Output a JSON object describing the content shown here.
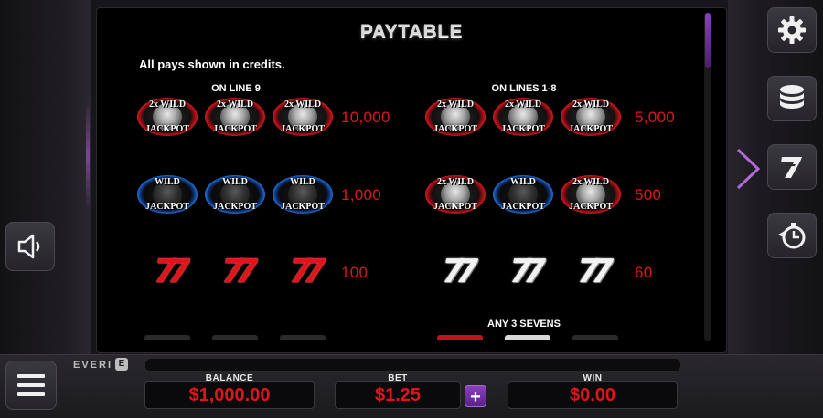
{
  "paytable": {
    "title": "PAYTABLE",
    "subtitle": "All pays shown in credits.",
    "col_left_heading": "ON LINE 9",
    "col_right_heading": "ON LINES 1-8",
    "any_sevens_heading": "ANY 3 SEVENS",
    "rows": [
      {
        "left": {
          "symbols": [
            "wild2x",
            "wild2x",
            "wild2x"
          ],
          "amount": "10,000"
        },
        "right": {
          "symbols": [
            "wild2x",
            "wild2x",
            "wild2x"
          ],
          "amount": "5,000"
        }
      },
      {
        "left": {
          "symbols": [
            "wild",
            "wild",
            "wild"
          ],
          "amount": "1,000"
        },
        "right": {
          "symbols": [
            "wild2x",
            "wild",
            "wild2x"
          ],
          "amount": "500"
        }
      },
      {
        "left": {
          "symbols": [
            "red7",
            "red7",
            "red7"
          ],
          "amount": "100"
        },
        "right": {
          "symbols": [
            "white7",
            "white7",
            "white7"
          ],
          "amount": "60"
        }
      }
    ],
    "badge_text": {
      "wild2x_top": "2x WILD",
      "wild_top": "WILD",
      "bottom": "JACKPOT"
    },
    "seven_glyph": "77"
  },
  "colors": {
    "accent_red": "#e0141b",
    "accent_purple": "#8a3fc0",
    "background": "#000000"
  },
  "icons": {
    "settings": "gear-icon",
    "bet": "coin-stack-icon",
    "paytable": "seven-icon",
    "autoplay": "stopwatch-icon",
    "sound": "speaker-icon",
    "menu": "hamburger-icon"
  },
  "footer": {
    "brand": "EVERI",
    "brand_mark": "E",
    "balance_label": "BALANCE",
    "balance_value": "$1,000.00",
    "bet_label": "BET",
    "bet_value": "$1.25",
    "bet_plus": "+",
    "win_label": "WIN",
    "win_value": "$0.00"
  }
}
